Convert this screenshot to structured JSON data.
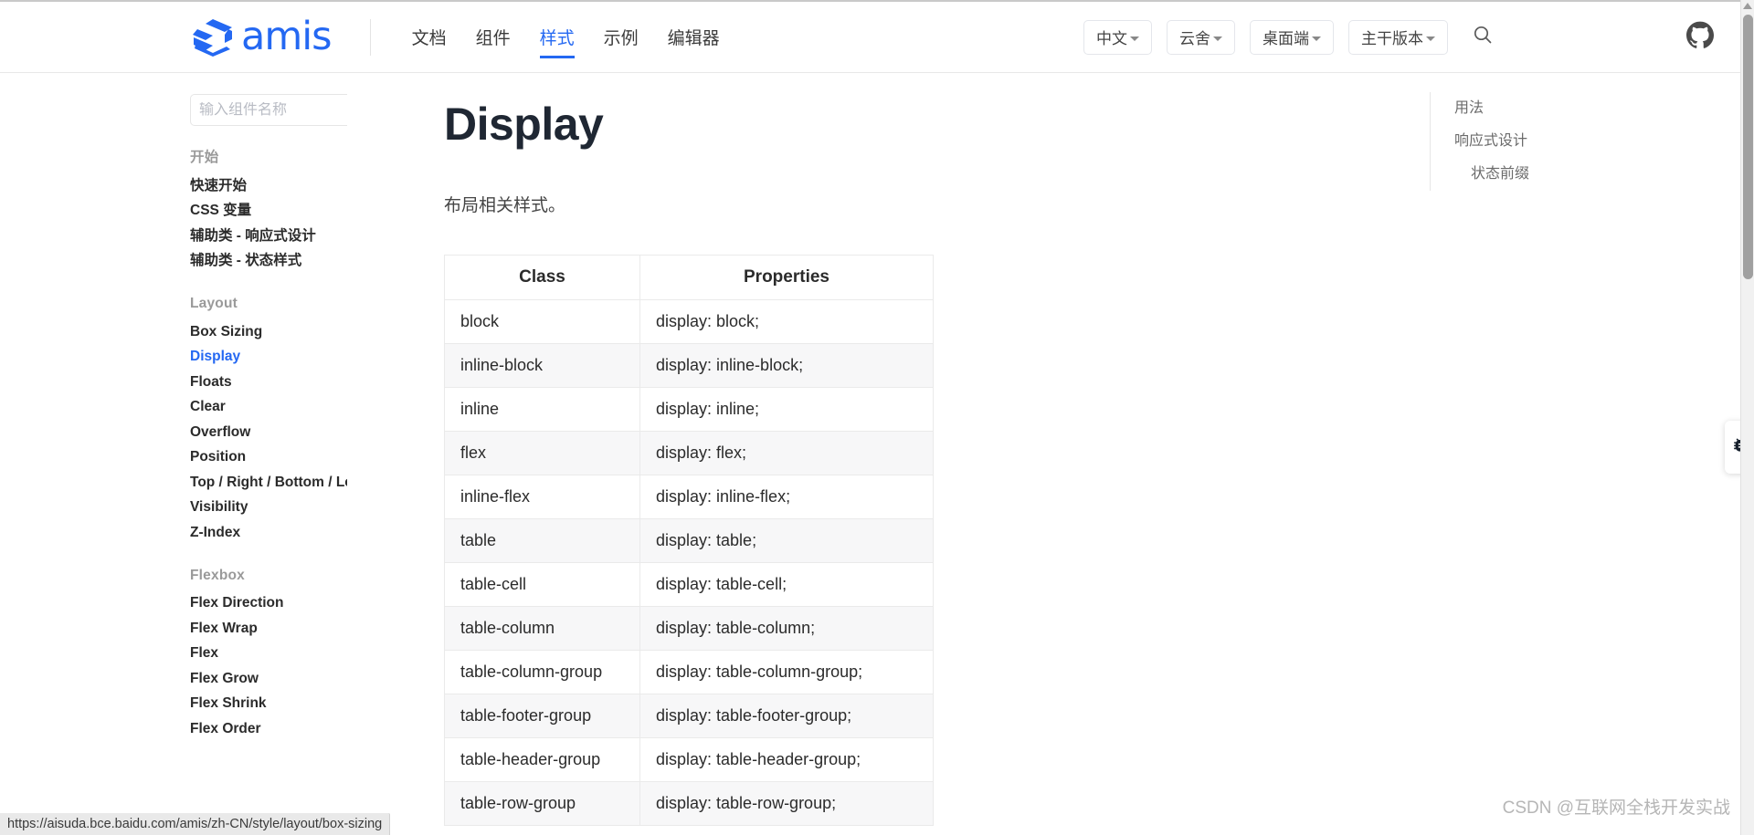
{
  "header": {
    "logo_text": "amis",
    "logo_icon": "amis-logo-icon",
    "nav": [
      {
        "label": "文档",
        "active": false
      },
      {
        "label": "组件",
        "active": false
      },
      {
        "label": "样式",
        "active": true
      },
      {
        "label": "示例",
        "active": false
      },
      {
        "label": "编辑器",
        "active": false
      }
    ],
    "selectors": [
      {
        "label": "中文",
        "name": "language-selector"
      },
      {
        "label": "云舍",
        "name": "theme-selector"
      },
      {
        "label": "桌面端",
        "name": "device-selector"
      },
      {
        "label": "主干版本",
        "name": "version-selector"
      }
    ],
    "search_icon": "search-icon",
    "github_icon": "github-icon"
  },
  "sidebar": {
    "search": {
      "placeholder": "输入组件名称",
      "value": "",
      "icon": "search-icon"
    },
    "groups": [
      {
        "title": "开始",
        "items": [
          {
            "label": "快速开始",
            "active": false
          },
          {
            "label": "CSS 变量",
            "active": false
          },
          {
            "label": "辅助类 - 响应式设计",
            "active": false
          },
          {
            "label": "辅助类 - 状态样式",
            "active": false
          }
        ]
      },
      {
        "title": "Layout",
        "items": [
          {
            "label": "Box Sizing",
            "active": false
          },
          {
            "label": "Display",
            "active": true
          },
          {
            "label": "Floats",
            "active": false
          },
          {
            "label": "Clear",
            "active": false
          },
          {
            "label": "Overflow",
            "active": false
          },
          {
            "label": "Position",
            "active": false
          },
          {
            "label": "Top / Right / Bottom / Left",
            "active": false
          },
          {
            "label": "Visibility",
            "active": false
          },
          {
            "label": "Z-Index",
            "active": false
          }
        ]
      },
      {
        "title": "Flexbox",
        "items": [
          {
            "label": "Flex Direction",
            "active": false
          },
          {
            "label": "Flex Wrap",
            "active": false
          },
          {
            "label": "Flex",
            "active": false
          },
          {
            "label": "Flex Grow",
            "active": false
          },
          {
            "label": "Flex Shrink",
            "active": false
          },
          {
            "label": "Flex Order",
            "active": false
          }
        ]
      }
    ]
  },
  "main": {
    "title": "Display",
    "description": "布局相关样式。",
    "table": {
      "columns": [
        "Class",
        "Properties"
      ],
      "rows": [
        [
          "block",
          "display: block;"
        ],
        [
          "inline-block",
          "display: inline-block;"
        ],
        [
          "inline",
          "display: inline;"
        ],
        [
          "flex",
          "display: flex;"
        ],
        [
          "inline-flex",
          "display: inline-flex;"
        ],
        [
          "table",
          "display: table;"
        ],
        [
          "table-cell",
          "display: table-cell;"
        ],
        [
          "table-column",
          "display: table-column;"
        ],
        [
          "table-column-group",
          "display: table-column-group;"
        ],
        [
          "table-footer-group",
          "display: table-footer-group;"
        ],
        [
          "table-header-group",
          "display: table-header-group;"
        ],
        [
          "table-row-group",
          "display: table-row-group;"
        ]
      ]
    }
  },
  "toc": {
    "items": [
      {
        "label": "用法",
        "sub": false
      },
      {
        "label": "响应式设计",
        "sub": false
      },
      {
        "label": "状态前缀",
        "sub": true
      }
    ]
  },
  "floating": {
    "bug_icon": "bug-icon"
  },
  "status_bar": {
    "url": "https://aisuda.bce.baidu.com/amis/zh-CN/style/layout/box-sizing"
  },
  "watermark": {
    "text": "CSDN @互联网全栈开发实战"
  },
  "colors": {
    "accent": "#2468f2",
    "text": "#2b2b2b",
    "muted": "#9a9a9a",
    "row_alt": "#f7f7f8"
  }
}
